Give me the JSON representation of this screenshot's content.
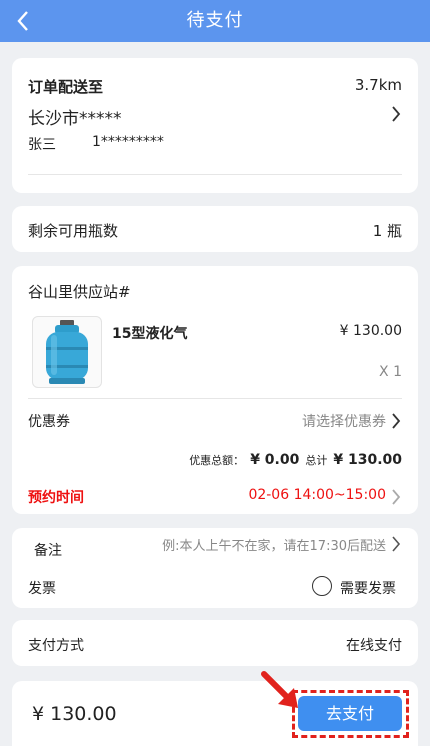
{
  "header": {
    "title": "待支付"
  },
  "address": {
    "label": "订单配送至",
    "distance": "3.7km",
    "city": "长沙市*****",
    "name": "张三",
    "phone": "1*********"
  },
  "bottles": {
    "label": "剩余可用瓶数",
    "value": "1 瓶"
  },
  "order": {
    "station": "谷山里供应站#",
    "product_name": "15型液化气",
    "price": "¥ 130.00",
    "quantity": "X 1",
    "coupon_label": "优惠券",
    "coupon_placeholder": "请选择优惠券",
    "discount_label": "优惠总额：",
    "discount_value": "¥ 0.00",
    "total_label": "总计",
    "total_value": "¥ 130.00",
    "appointment_label": "预约时间",
    "appointment_value": "02-06 14:00~15:00"
  },
  "notes": {
    "remark_label": "备注",
    "remark_placeholder": "例:本人上午不在家，请在17:30后配送",
    "invoice_label": "发票",
    "invoice_option": "需要发票"
  },
  "payment": {
    "label": "支付方式",
    "value": "在线支付"
  },
  "footer": {
    "amount": "¥ 130.00",
    "pay_button": "去支付"
  },
  "colors": {
    "header": "#5c95ee",
    "button": "#3f8ff0",
    "highlight": "#ee1111"
  }
}
